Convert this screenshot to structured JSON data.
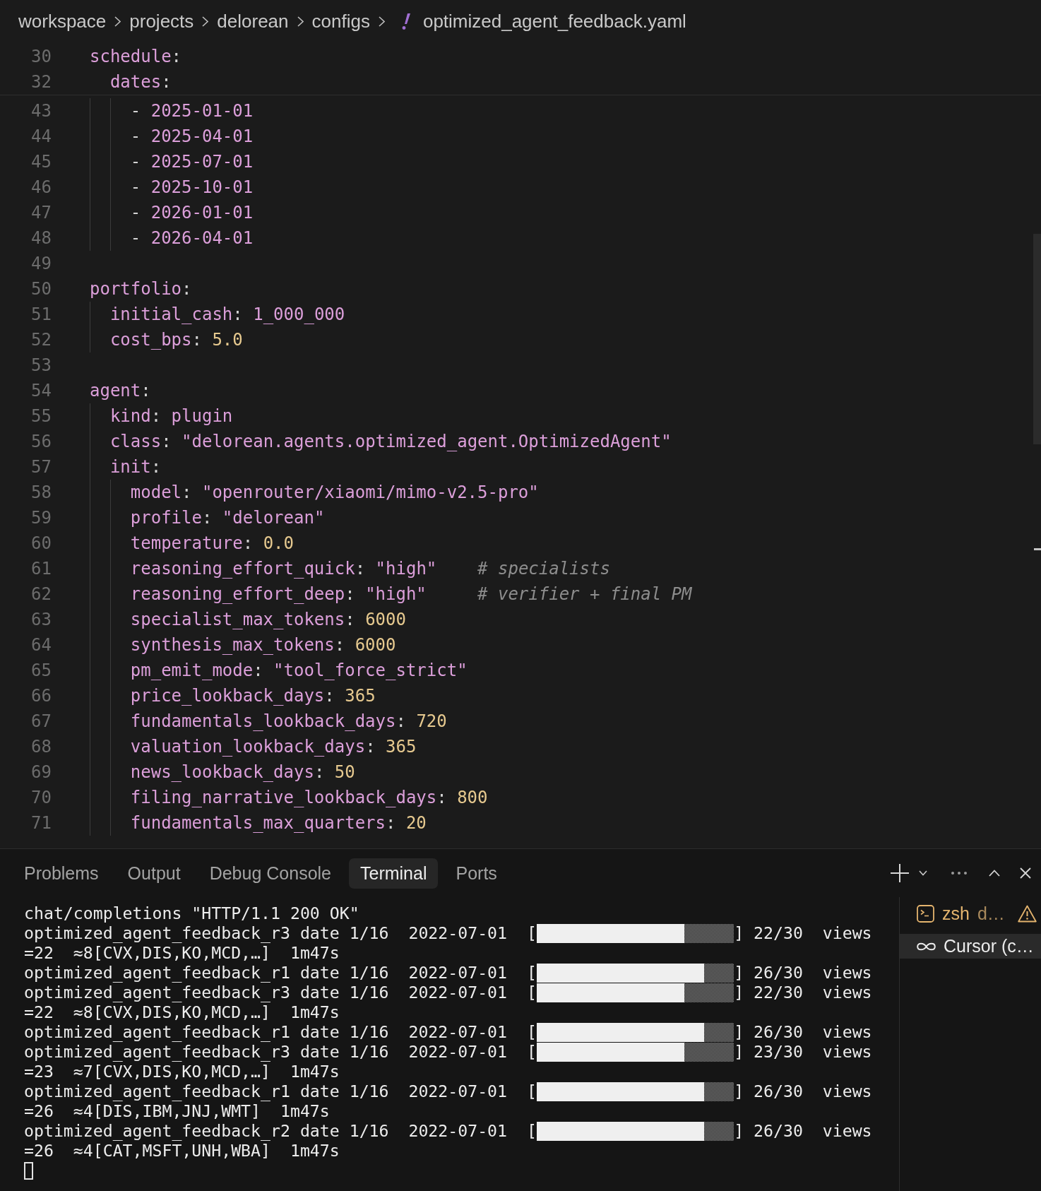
{
  "breadcrumb": {
    "items": [
      {
        "label": "workspace",
        "kind": "folder"
      },
      {
        "label": "projects",
        "kind": "folder"
      },
      {
        "label": "delorean",
        "kind": "folder"
      },
      {
        "label": "configs",
        "kind": "folder"
      },
      {
        "label": "optimized_agent_feedback.yaml",
        "kind": "file"
      }
    ]
  },
  "editor": {
    "sticky_scroll": true,
    "lines": [
      {
        "number": "30",
        "tokens": [
          {
            "kind": "key",
            "text": "schedule"
          },
          {
            "kind": "plain",
            "text": ":"
          }
        ],
        "children": [
          {
            "number": "32",
            "tokens": [
              {
                "kind": "key",
                "text": "dates"
              },
              {
                "kind": "plain",
                "text": ":"
              }
            ],
            "children": [
              {
                "number": "43",
                "tokens": [
                  {
                    "kind": "plain",
                    "text": "- "
                  },
                  {
                    "kind": "string",
                    "text": "2025-01-01"
                  }
                ]
              },
              {
                "number": "44",
                "tokens": [
                  {
                    "kind": "plain",
                    "text": "- "
                  },
                  {
                    "kind": "string",
                    "text": "2025-04-01"
                  }
                ]
              },
              {
                "number": "45",
                "tokens": [
                  {
                    "kind": "plain",
                    "text": "- "
                  },
                  {
                    "kind": "string",
                    "text": "2025-07-01"
                  }
                ]
              },
              {
                "number": "46",
                "tokens": [
                  {
                    "kind": "plain",
                    "text": "- "
                  },
                  {
                    "kind": "string",
                    "text": "2025-10-01"
                  }
                ]
              },
              {
                "number": "47",
                "tokens": [
                  {
                    "kind": "plain",
                    "text": "- "
                  },
                  {
                    "kind": "string",
                    "text": "2026-01-01"
                  }
                ]
              },
              {
                "number": "48",
                "tokens": [
                  {
                    "kind": "plain",
                    "text": "- "
                  },
                  {
                    "kind": "string",
                    "text": "2026-04-01"
                  }
                ]
              }
            ]
          }
        ]
      },
      {
        "number": "49"
      },
      {
        "number": "50",
        "tokens": [
          {
            "kind": "key",
            "text": "portfolio"
          },
          {
            "kind": "plain",
            "text": ":"
          }
        ],
        "children": [
          {
            "number": "51",
            "tokens": [
              {
                "kind": "key",
                "text": "initial_cash"
              },
              {
                "kind": "plain",
                "text": ": "
              },
              {
                "kind": "string",
                "text": "1_000_000"
              }
            ]
          },
          {
            "number": "52",
            "tokens": [
              {
                "kind": "key",
                "text": "cost_bps"
              },
              {
                "kind": "plain",
                "text": ": "
              },
              {
                "kind": "number",
                "text": "5.0"
              }
            ]
          }
        ]
      },
      {
        "number": "53"
      },
      {
        "number": "54",
        "tokens": [
          {
            "kind": "key",
            "text": "agent"
          },
          {
            "kind": "plain",
            "text": ":"
          }
        ],
        "children": [
          {
            "number": "55",
            "tokens": [
              {
                "kind": "key",
                "text": "kind"
              },
              {
                "kind": "plain",
                "text": ": "
              },
              {
                "kind": "string",
                "text": "plugin"
              }
            ]
          },
          {
            "number": "56",
            "tokens": [
              {
                "kind": "key",
                "text": "class"
              },
              {
                "kind": "plain",
                "text": ": "
              },
              {
                "kind": "string",
                "text": "\"delorean.agents.optimized_agent.OptimizedAgent\""
              }
            ]
          },
          {
            "number": "57",
            "tokens": [
              {
                "kind": "key",
                "text": "init"
              },
              {
                "kind": "plain",
                "text": ":"
              }
            ],
            "children": [
              {
                "number": "58",
                "tokens": [
                  {
                    "kind": "key",
                    "text": "model"
                  },
                  {
                    "kind": "plain",
                    "text": ": "
                  },
                  {
                    "kind": "string",
                    "text": "\"openrouter/xiaomi/mimo-v2.5-pro\""
                  }
                ]
              },
              {
                "number": "59",
                "tokens": [
                  {
                    "kind": "key",
                    "text": "profile"
                  },
                  {
                    "kind": "plain",
                    "text": ": "
                  },
                  {
                    "kind": "string",
                    "text": "\"delorean\""
                  }
                ]
              },
              {
                "number": "60",
                "tokens": [
                  {
                    "kind": "key",
                    "text": "temperature"
                  },
                  {
                    "kind": "plain",
                    "text": ": "
                  },
                  {
                    "kind": "number",
                    "text": "0.0"
                  }
                ]
              },
              {
                "number": "61",
                "tokens": [
                  {
                    "kind": "key",
                    "text": "reasoning_effort_quick"
                  },
                  {
                    "kind": "plain",
                    "text": ": "
                  },
                  {
                    "kind": "string",
                    "text": "\"high\""
                  },
                  {
                    "kind": "comment",
                    "text": "    # specialists"
                  }
                ]
              },
              {
                "number": "62",
                "tokens": [
                  {
                    "kind": "key",
                    "text": "reasoning_effort_deep"
                  },
                  {
                    "kind": "plain",
                    "text": ": "
                  },
                  {
                    "kind": "string",
                    "text": "\"high\""
                  },
                  {
                    "kind": "comment",
                    "text": "     # verifier + final PM"
                  }
                ]
              },
              {
                "number": "63",
                "tokens": [
                  {
                    "kind": "key",
                    "text": "specialist_max_tokens"
                  },
                  {
                    "kind": "plain",
                    "text": ": "
                  },
                  {
                    "kind": "number",
                    "text": "6000"
                  }
                ]
              },
              {
                "number": "64",
                "tokens": [
                  {
                    "kind": "key",
                    "text": "synthesis_max_tokens"
                  },
                  {
                    "kind": "plain",
                    "text": ": "
                  },
                  {
                    "kind": "number",
                    "text": "6000"
                  }
                ]
              },
              {
                "number": "65",
                "tokens": [
                  {
                    "kind": "key",
                    "text": "pm_emit_mode"
                  },
                  {
                    "kind": "plain",
                    "text": ": "
                  },
                  {
                    "kind": "string",
                    "text": "\"tool_force_strict\""
                  }
                ]
              },
              {
                "number": "66",
                "tokens": [
                  {
                    "kind": "key",
                    "text": "price_lookback_days"
                  },
                  {
                    "kind": "plain",
                    "text": ": "
                  },
                  {
                    "kind": "number",
                    "text": "365"
                  }
                ]
              },
              {
                "number": "67",
                "tokens": [
                  {
                    "kind": "key",
                    "text": "fundamentals_lookback_days"
                  },
                  {
                    "kind": "plain",
                    "text": ": "
                  },
                  {
                    "kind": "number",
                    "text": "720"
                  }
                ]
              },
              {
                "number": "68",
                "tokens": [
                  {
                    "kind": "key",
                    "text": "valuation_lookback_days"
                  },
                  {
                    "kind": "plain",
                    "text": ": "
                  },
                  {
                    "kind": "number",
                    "text": "365"
                  }
                ]
              },
              {
                "number": "69",
                "tokens": [
                  {
                    "kind": "key",
                    "text": "news_lookback_days"
                  },
                  {
                    "kind": "plain",
                    "text": ": "
                  },
                  {
                    "kind": "number",
                    "text": "50"
                  }
                ]
              },
              {
                "number": "70",
                "tokens": [
                  {
                    "kind": "key",
                    "text": "filing_narrative_lookback_days"
                  },
                  {
                    "kind": "plain",
                    "text": ": "
                  },
                  {
                    "kind": "number",
                    "text": "800"
                  }
                ]
              },
              {
                "number": "71",
                "tokens": [
                  {
                    "kind": "key",
                    "text": "fundamentals_max_quarters"
                  },
                  {
                    "kind": "plain",
                    "text": ": "
                  },
                  {
                    "kind": "number",
                    "text": "20"
                  }
                ]
              }
            ]
          }
        ]
      }
    ]
  },
  "panel": {
    "tabs": [
      {
        "label": "Problems",
        "selected": false
      },
      {
        "label": "Output",
        "selected": false
      },
      {
        "label": "Debug Console",
        "selected": false
      },
      {
        "label": "Terminal",
        "selected": true
      },
      {
        "label": "Ports",
        "selected": false
      }
    ],
    "terminal": {
      "cursor": true,
      "lines": [
        {
          "kind": "text",
          "text": "chat/completions \"HTTP/1.1 200 OK\""
        },
        {
          "kind": "progress",
          "before": "optimized_agent_feedback_r3 date 1/16  2022-07-01  [",
          "level": 0.75,
          "after": "] 22/30  views"
        },
        {
          "kind": "text",
          "text": "=22  ≈8[CVX,DIS,KO,MCD,…]  1m47s"
        },
        {
          "kind": "progress",
          "before": "optimized_agent_feedback_r1 date 1/16  2022-07-01  [",
          "level": 0.85,
          "after": "] 26/30  views"
        },
        {
          "kind": "progress",
          "before": "optimized_agent_feedback_r3 date 1/16  2022-07-01  [",
          "level": 0.75,
          "after": "] 22/30  views"
        },
        {
          "kind": "text",
          "text": "=22  ≈8[CVX,DIS,KO,MCD,…]  1m47s"
        },
        {
          "kind": "progress",
          "before": "optimized_agent_feedback_r1 date 1/16  2022-07-01  [",
          "level": 0.85,
          "after": "] 26/30  views"
        },
        {
          "kind": "progress",
          "before": "optimized_agent_feedback_r3 date 1/16  2022-07-01  [",
          "level": 0.75,
          "after": "] 23/30  views"
        },
        {
          "kind": "text",
          "text": "=23  ≈7[CVX,DIS,KO,MCD,…]  1m47s"
        },
        {
          "kind": "progress",
          "before": "optimized_agent_feedback_r1 date 1/16  2022-07-01  [",
          "level": 0.85,
          "after": "] 26/30  views"
        },
        {
          "kind": "text",
          "text": "=26  ≈4[DIS,IBM,JNJ,WMT]  1m47s"
        },
        {
          "kind": "progress",
          "before": "optimized_agent_feedback_r2 date 1/16  2022-07-01  [",
          "level": 0.85,
          "after": "] 26/30  views"
        },
        {
          "kind": "text",
          "text": "=26  ≈4[CAT,MSFT,UNH,WBA]  1m47s"
        }
      ]
    },
    "terminal_list": [
      {
        "name": "zsh",
        "detail": "d…",
        "kind": "shell",
        "warning": true,
        "selected": false
      },
      {
        "name": "Cursor (c…",
        "kind": "cursor",
        "warning": false,
        "selected": true
      }
    ]
  }
}
